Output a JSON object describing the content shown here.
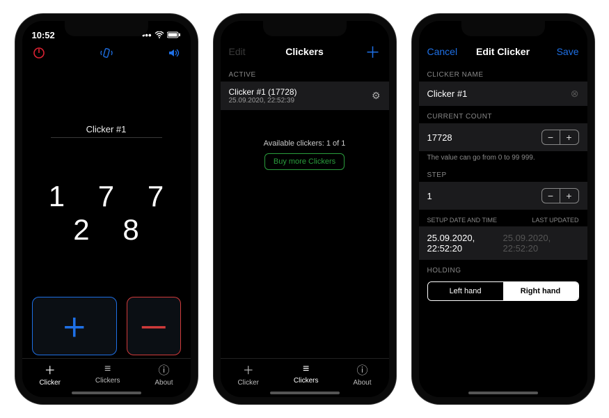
{
  "status": {
    "time": "10:52"
  },
  "screen1": {
    "title": "Clicker #1",
    "count": "1 7 7 2 8",
    "tabs": {
      "t1": "Clicker",
      "t2": "Clickers",
      "t3": "About"
    }
  },
  "screen2": {
    "nav": {
      "left": "Edit",
      "title": "Clickers",
      "plus": "＋"
    },
    "section_active": "ACTIVE",
    "active": {
      "line1": "Clicker #1 (17728)",
      "line2": "25.09.2020, 22:52:39"
    },
    "available": "Available clickers: 1 of 1",
    "buy": "Buy more Clickers",
    "tabs": {
      "t1": "Clicker",
      "t2": "Clickers",
      "t3": "About"
    }
  },
  "screen3": {
    "nav": {
      "left": "Cancel",
      "title": "Edit Clicker",
      "right": "Save"
    },
    "labels": {
      "name": "CLICKER NAME",
      "count": "CURRENT COUNT",
      "step": "STEP",
      "setup": "SETUP DATE AND TIME",
      "updated": "LAST UPDATED",
      "holding": "HOLDING"
    },
    "values": {
      "name": "Clicker #1",
      "count": "17728",
      "count_hint": "The value can go from 0 to 99 999.",
      "step": "1",
      "setup": "25.09.2020, 22:52:20",
      "updated": "25.09.2020, 22:52:20"
    },
    "seg": {
      "left": "Left hand",
      "right": "Right hand"
    }
  }
}
